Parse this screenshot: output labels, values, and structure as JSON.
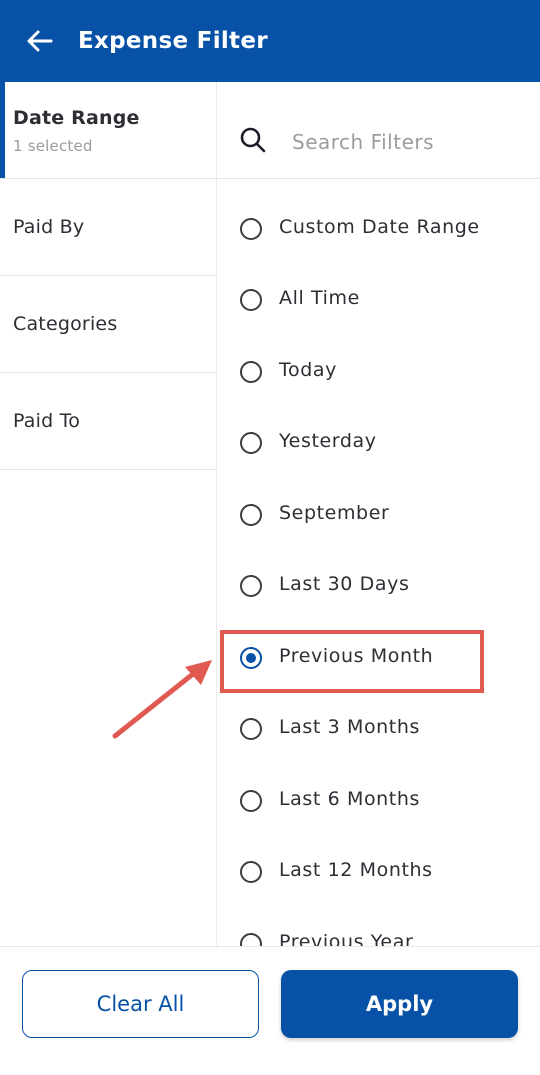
{
  "header": {
    "title": "Expense Filter",
    "back_icon": "arrow-left-icon"
  },
  "sidebar": {
    "items": [
      {
        "label": "Date Range",
        "sub": "1 selected",
        "active": true
      },
      {
        "label": "Paid By"
      },
      {
        "label": "Categories"
      },
      {
        "label": "Paid To"
      }
    ]
  },
  "search": {
    "placeholder": "Search Filters",
    "value": ""
  },
  "date_options": [
    {
      "label": "Custom Date Range",
      "selected": false
    },
    {
      "label": "All Time",
      "selected": false
    },
    {
      "label": "Today",
      "selected": false
    },
    {
      "label": "Yesterday",
      "selected": false
    },
    {
      "label": "September",
      "selected": false
    },
    {
      "label": "Last 30 Days",
      "selected": false
    },
    {
      "label": "Previous Month",
      "selected": true
    },
    {
      "label": "Last 3 Months",
      "selected": false
    },
    {
      "label": "Last 6 Months",
      "selected": false
    },
    {
      "label": "Last 12 Months",
      "selected": false
    },
    {
      "label": "Previous Year",
      "selected": false
    }
  ],
  "footer": {
    "clear_label": "Clear All",
    "apply_label": "Apply"
  },
  "colors": {
    "primary": "#0751a6",
    "annotation": "#e05a52"
  }
}
